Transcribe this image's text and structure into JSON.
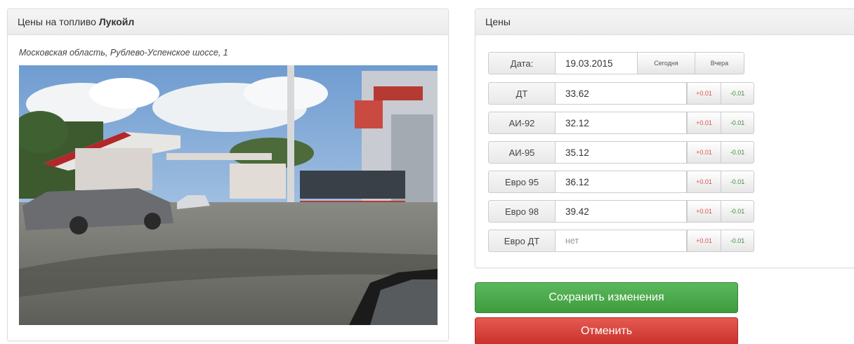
{
  "left_panel": {
    "title_prefix": "Цены на топливо ",
    "title_brand": "Лукойл",
    "address": "Московская область, Рублево-Успенское шоссе, 1"
  },
  "right_panel": {
    "title": "Цены",
    "date": {
      "label": "Дата:",
      "value": "19.03.2015",
      "today_label": "Сегодня",
      "yesterday_label": "Вчера"
    },
    "plus_label": "+0.01",
    "minus_label": "-0.01",
    "fuels": [
      {
        "label": "ДТ",
        "value": "33.62",
        "placeholder": ""
      },
      {
        "label": "АИ-92",
        "value": "32.12",
        "placeholder": ""
      },
      {
        "label": "АИ-95",
        "value": "35.12",
        "placeholder": ""
      },
      {
        "label": "Евро 95",
        "value": "36.12",
        "placeholder": ""
      },
      {
        "label": "Евро 98",
        "value": "39.42",
        "placeholder": ""
      },
      {
        "label": "Евро ДТ",
        "value": "",
        "placeholder": "нет"
      }
    ]
  },
  "actions": {
    "save_label": "Сохранить изменения",
    "cancel_label": "Отменить"
  },
  "colors": {
    "save": "#5cb85c",
    "cancel": "#d9534f",
    "plus_text": "#d9534f",
    "minus_text": "#3c8d3c"
  }
}
